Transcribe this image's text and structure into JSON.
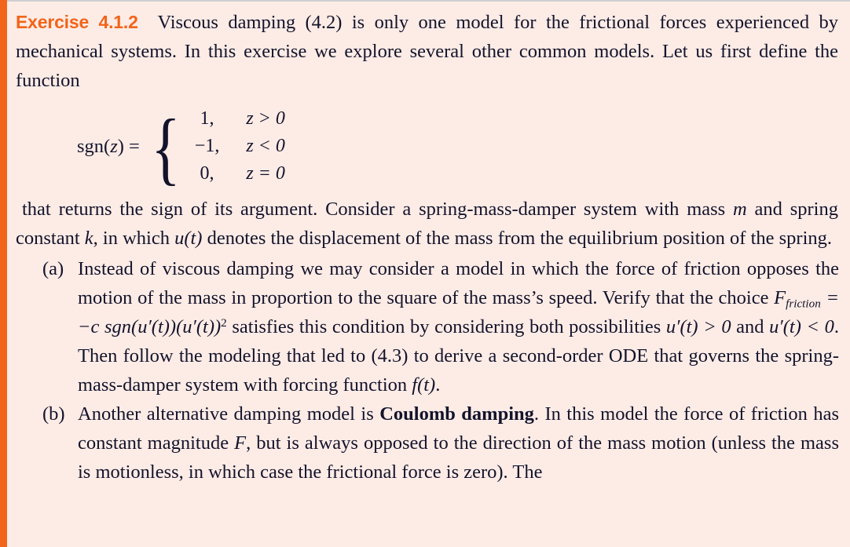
{
  "colors": {
    "background": "#fdece6",
    "accent_bar": "#f2641a",
    "heading": "#f2641a",
    "body_text": "#13132b",
    "top_rule": "#cfcfcf"
  },
  "exercise": {
    "label": "Exercise 4.1.2",
    "lead_paragraph": "Viscous damping (4.2) is only one model for the frictional forces experienced by mechanical systems. In this exercise we explore several other common models. Let us first define the function"
  },
  "equation": {
    "lhs": "sgn(z) =",
    "cases": [
      {
        "value": "1,",
        "condition": "z > 0"
      },
      {
        "value": "−1,",
        "condition": "z < 0"
      },
      {
        "value": "0,",
        "condition": "z = 0"
      }
    ]
  },
  "setup_paragraph": {
    "part1": "that returns the sign of its argument. Consider a spring-mass-damper system with mass ",
    "var_m": "m",
    "part2": " and spring constant ",
    "var_k": "k",
    "part3": ", in which ",
    "var_ut": "u(t)",
    "part4": " denotes the displacement of the mass from the equilibrium position of the spring."
  },
  "parts": [
    {
      "marker": "(a)",
      "text_1": "Instead of viscous damping we may consider a model in which the force of friction opposes the motion of the mass in proportion to the square of the mass’s speed. Verify that the choice ",
      "formula_F": "F",
      "formula_sub": "friction",
      "formula_rest": " = −c sgn(u′(t))(u′(t))",
      "formula_exp": "2",
      "text_2": " satisfies this condition by considering both possibilities ",
      "cond_1": "u′(t) > 0",
      "text_3": " and ",
      "cond_2": "u′(t) < 0",
      "text_4": ". Then follow the modeling that led to (4.3) to derive a second-order ODE that governs the spring-mass-damper system with forcing function ",
      "text_5": "f(t)",
      "text_6": "."
    },
    {
      "marker": "(b)",
      "text_1": "Another alternative damping model is ",
      "bold_term": "Coulomb damping",
      "text_2": ". In this model the force of friction has constant magnitude ",
      "var_F": "F",
      "text_3": ", but is always opposed to the direction of the mass motion (unless the mass is motionless, in which case the frictional force is zero). The"
    }
  ]
}
